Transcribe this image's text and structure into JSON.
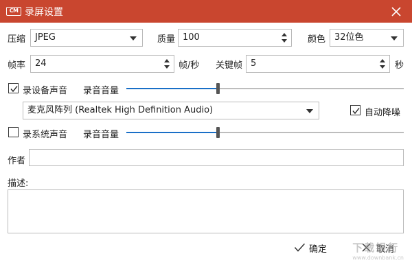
{
  "window": {
    "title": "录屏设置",
    "app_icon_text": "CM",
    "accent_color": "#c9462f"
  },
  "row1": {
    "compress_label": "压缩",
    "compress_value": "JPEG",
    "quality_label": "质量",
    "quality_value": "100",
    "color_label": "颜色",
    "color_value": "32位色"
  },
  "row2": {
    "fps_label": "帧率",
    "fps_value": "24",
    "fps_unit": "帧/秒",
    "keyframe_label": "关键帧",
    "keyframe_value": "5",
    "keyframe_unit": "秒"
  },
  "device_audio": {
    "checkbox_label": "录设备声音",
    "checked": true,
    "volume_label": "录音音量",
    "volume_fraction": 0.33,
    "device_value": "麦克风阵列 (Realtek High Definition Audio)",
    "auto_denoise_label": "自动降噪",
    "auto_denoise_checked": true
  },
  "system_audio": {
    "checkbox_label": "录系统声音",
    "checked": false,
    "volume_label": "录音音量",
    "volume_fraction": 0.33
  },
  "author": {
    "label": "作者",
    "value": ""
  },
  "description": {
    "label": "描述:",
    "value": ""
  },
  "buttons": {
    "ok_label": "确定",
    "cancel_label": "取消"
  },
  "watermark": {
    "text": "下载银行",
    "url_text": "www.downbank.cn"
  }
}
